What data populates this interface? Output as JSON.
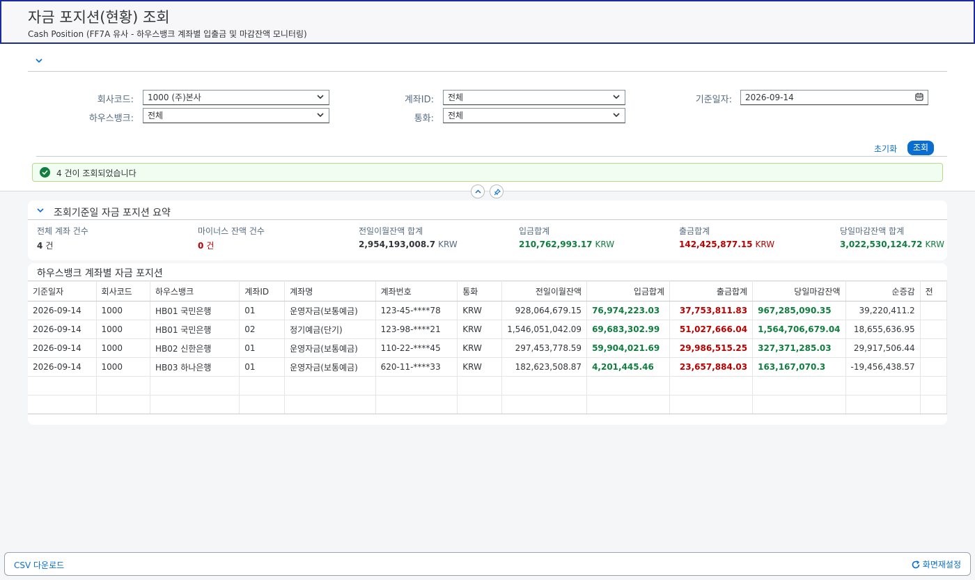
{
  "header": {
    "title": "자금 포지션(현황) 조회",
    "subtitle": "Cash Position (FF7A 유사 - 하우스뱅크 계좌별 입출금 및 마감잔액 모니터링)"
  },
  "filters": {
    "company_label": "회사코드:",
    "company_value": "1000 (주)본사",
    "account_label": "계좌ID:",
    "account_value": "전체",
    "date_label": "기준일자:",
    "date_value": "2026-09-14",
    "housebank_label": "하우스뱅크:",
    "housebank_value": "전체",
    "currency_label": "통화:",
    "currency_value": "전체",
    "reset_label": "초기화",
    "search_label": "조회"
  },
  "message": "4 건이 조회되었습니다",
  "summary": {
    "title": "조회기준일 자금 포지션 요약",
    "total_accounts_label": "전체 계좌 건수",
    "total_accounts_value": "4",
    "total_accounts_unit": "건",
    "minus_label": "마이너스 잔액 건수",
    "minus_value": "0",
    "minus_unit": "건",
    "prev_label": "전일이월잔액 합계",
    "prev_value": "2,954,193,008.7",
    "in_label": "입금합계",
    "in_value": "210,762,993.17",
    "out_label": "출금합계",
    "out_value": "142,425,877.15",
    "close_label": "당일마감잔액 합계",
    "close_value": "3,022,530,124.72",
    "currency": "KRW"
  },
  "table": {
    "title": "하우스뱅크 계좌별 자금 포지션",
    "columns": [
      "기준일자",
      "회사코드",
      "하우스뱅크",
      "계좌ID",
      "계좌명",
      "계좌번호",
      "통화",
      "전일이월잔액",
      "입금합계",
      "출금합계",
      "당일마감잔액",
      "순증감",
      "전"
    ],
    "rows": [
      [
        "2026-09-14",
        "1000",
        "HB01 국민은행",
        "01",
        "운영자금(보통예금)",
        "123-45-****78",
        "KRW",
        "928,064,679.15",
        "76,974,223.03",
        "37,753,811.83",
        "967,285,090.35",
        "39,220,411.2"
      ],
      [
        "2026-09-14",
        "1000",
        "HB01 국민은행",
        "02",
        "정기예금(단기)",
        "123-98-****21",
        "KRW",
        "1,546,051,042.09",
        "69,683,302.99",
        "51,027,666.04",
        "1,564,706,679.04",
        "18,655,636.95"
      ],
      [
        "2026-09-14",
        "1000",
        "HB02 신한은행",
        "01",
        "운영자금(보통예금)",
        "110-22-****45",
        "KRW",
        "297,453,778.59",
        "59,904,021.69",
        "29,986,515.25",
        "327,371,285.03",
        "29,917,506.44"
      ],
      [
        "2026-09-14",
        "1000",
        "HB03 하나은행",
        "01",
        "운영자금(보통예금)",
        "620-11-****33",
        "KRW",
        "182,623,508.87",
        "4,201,445.46",
        "23,657,884.03",
        "163,167,070.3",
        "-19,456,438.57"
      ]
    ]
  },
  "footer": {
    "csv_label": "CSV 다운로드",
    "reset_label": "화면재설정"
  },
  "colors": {
    "accent": "#0a6ed1",
    "positive": "#107e3e",
    "negative": "#bb0000"
  }
}
